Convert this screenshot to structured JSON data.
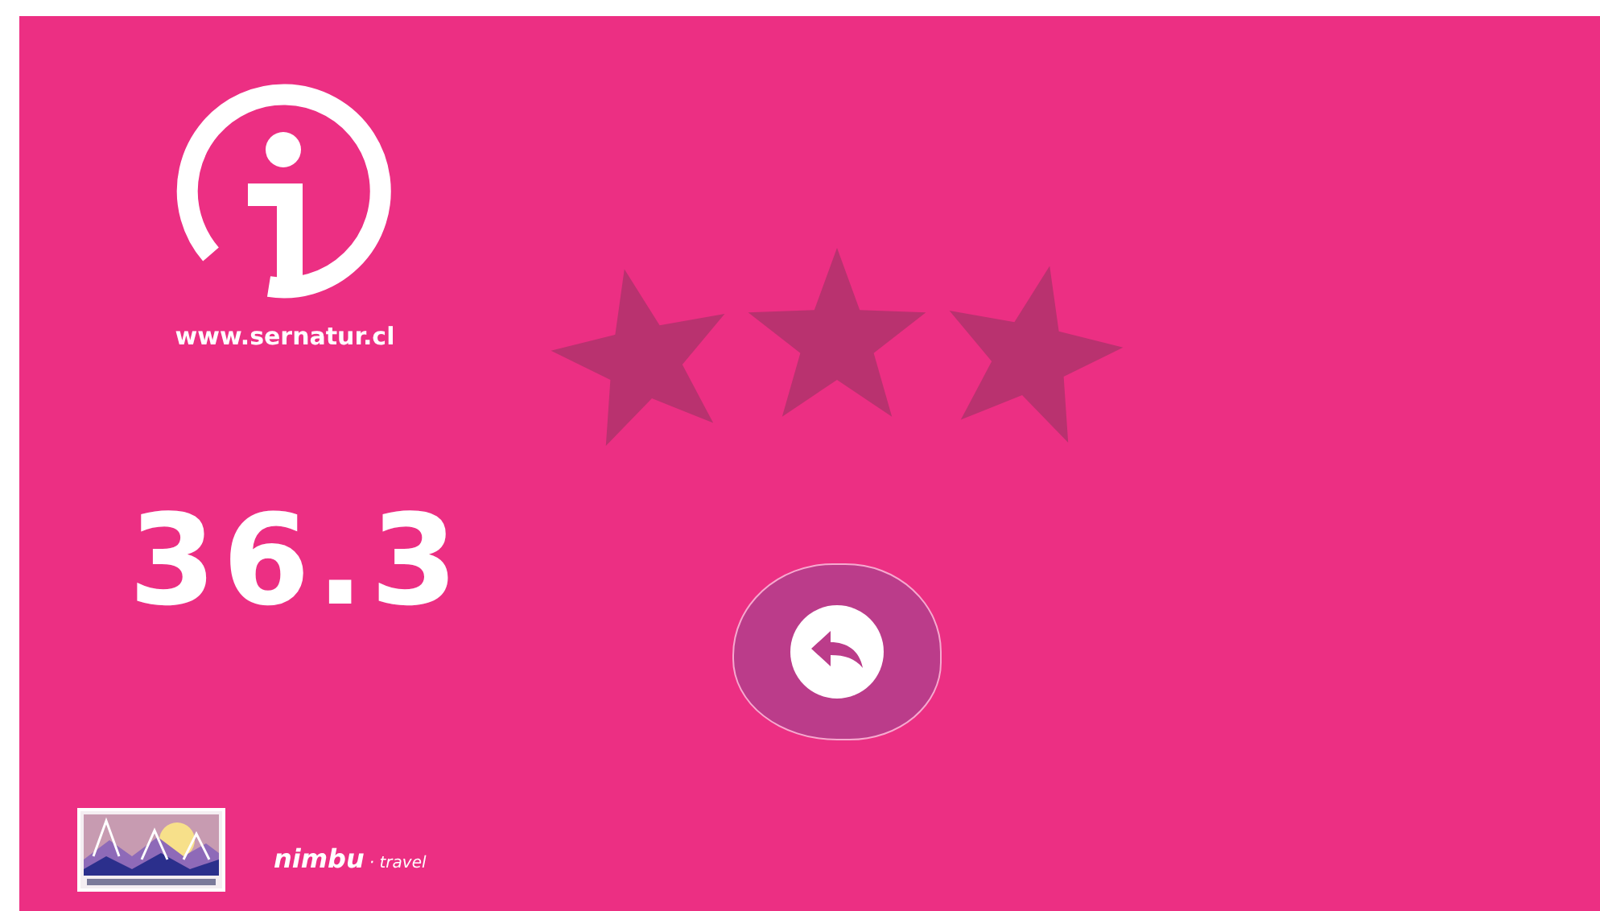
{
  "website": "www.sernatur.cl",
  "reading": "36.3",
  "rating": {
    "stars": 3
  },
  "sponsor": {
    "name": "nimbu",
    "suffix": "· travel"
  }
}
